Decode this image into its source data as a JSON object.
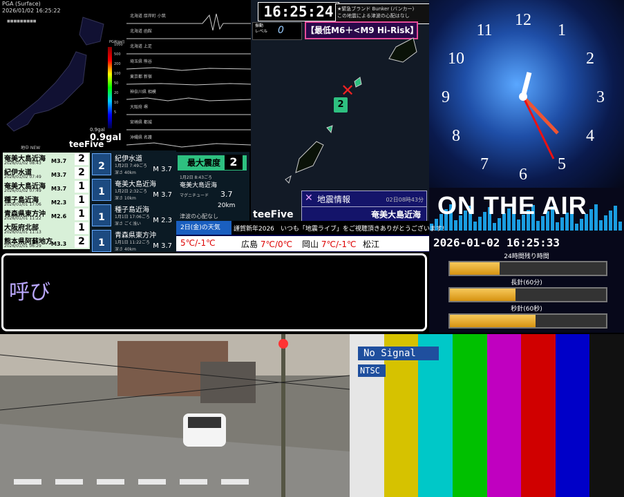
{
  "pga": {
    "title": "PGA (Surface)",
    "datetime": "2026/01/02 16:25:22",
    "unit_label": "PGA[gal]",
    "scale_ticks": [
      "1000",
      "500",
      "200",
      "100",
      "50",
      "20",
      "10",
      "5",
      "2",
      "1"
    ],
    "current_gal": "0.9gal",
    "gal_label": "0.9gal",
    "brand": "teeFive",
    "notice": "地中 NEW"
  },
  "waves": {
    "rows": [
      "北海道 厚岸町 小筑",
      "北海道 函館",
      "北海道 上足",
      "埼玉県 熊谷",
      "東京都 新宿",
      "神奈川県 相模",
      "大阪府 堺",
      "宮崎県 都城",
      "沖縄県 名護"
    ]
  },
  "map": {
    "clock": "16:25:24",
    "info_line1": "★緊急ブランド Bunker (バンカー)",
    "info_line2": "この地震による津波の心配はなし",
    "level_label": "振動\nレベル",
    "level_value": "0",
    "risk": "【最低M6＋<M9 Hi-Risk】",
    "epicenter_mark": "✕",
    "intensity": "2",
    "brand": "teeFive",
    "eq_title": "地震情報",
    "eq_time": "02日08時43分",
    "eq_region": "奄美大島近海"
  },
  "quake_list": [
    {
      "name": "奄美大島近海",
      "date": "2026/01/02 08:43",
      "mag": "M3.7",
      "int": "2"
    },
    {
      "name": "紀伊水道",
      "date": "2026/01/02 07:49",
      "mag": "M3.7",
      "int": "2"
    },
    {
      "name": "奄美大島近海",
      "date": "2026/01/02 07:49",
      "mag": "M3.7",
      "int": "1"
    },
    {
      "name": "種子島近海",
      "date": "2026/01/01 17:06",
      "mag": "M2.3",
      "int": "1"
    },
    {
      "name": "青森県東方沖",
      "date": "2026/01/01 11:22",
      "mag": "M2.6",
      "int": "1"
    },
    {
      "name": "大阪府北部",
      "date": "2026/01/01 11:13",
      "mag": "",
      "int": "1"
    },
    {
      "name": "熊本県阿蘇地方",
      "date": "2026/01/01 06:29",
      "mag": "M3.3",
      "int": "2"
    }
  ],
  "quake_detail": [
    {
      "int": "2",
      "name": "紀伊水道",
      "time": "1月2日 7:49ごろ",
      "depth": "深さ 40km",
      "mag": "M 3.7"
    },
    {
      "int": "1",
      "name": "奄美大島近海",
      "time": "1月2日 2:32ごろ",
      "depth": "深さ 10km",
      "mag": "M 3.7"
    },
    {
      "int": "1",
      "name": "種子島近海",
      "time": "1月1日 17:06ごろ",
      "depth": "深さ ごく浅い",
      "mag": "M 2.3"
    },
    {
      "int": "1",
      "name": "青森県東方沖",
      "time": "1月1日 11:22ごろ",
      "depth": "深さ 40km",
      "mag": "M 3.7"
    }
  ],
  "max_intensity": {
    "label": "最大震度",
    "value": "2",
    "time": "1月2日 8:43ごろ",
    "region": "奄美大島近海",
    "mag_label": "マグニチュード",
    "mag": "3.7",
    "depth": "20km",
    "tsunami": "津波の心配なし"
  },
  "weather": {
    "date": "2日(金)の天気",
    "ticker": "謹賀新年2026　いつも「地震ライブ」をご視聴頂きありがとうございます!",
    "cities": [
      {
        "name": "",
        "temp": "5℃/-1℃"
      },
      {
        "name": "広島",
        "temp": "7℃/0℃"
      },
      {
        "name": "岡山",
        "temp": "7℃/-1℃"
      },
      {
        "name": "松江",
        "temp": ""
      }
    ]
  },
  "callout": {
    "text": "呼び"
  },
  "clock_face": {
    "numerals": [
      "12",
      "1",
      "2",
      "3",
      "4",
      "5",
      "6",
      "7",
      "8",
      "9",
      "10",
      "11"
    ]
  },
  "onair": {
    "title": "ON THE AIR",
    "datetime": "2026-01-02 16:25:33",
    "bars": [
      {
        "label": "24時間残り時間",
        "fill": 0.32
      },
      {
        "label": "長針(60分)",
        "fill": 0.42
      },
      {
        "label": "秒針(60秒)",
        "fill": 0.55
      }
    ]
  },
  "tv": {
    "no_signal": "No Signal",
    "ntsc": "NTSC",
    "colors": [
      "#e6e6e6",
      "#d6c200",
      "#00c8c8",
      "#00c000",
      "#c000c0",
      "#d00000",
      "#0000c8",
      "#111111"
    ]
  }
}
